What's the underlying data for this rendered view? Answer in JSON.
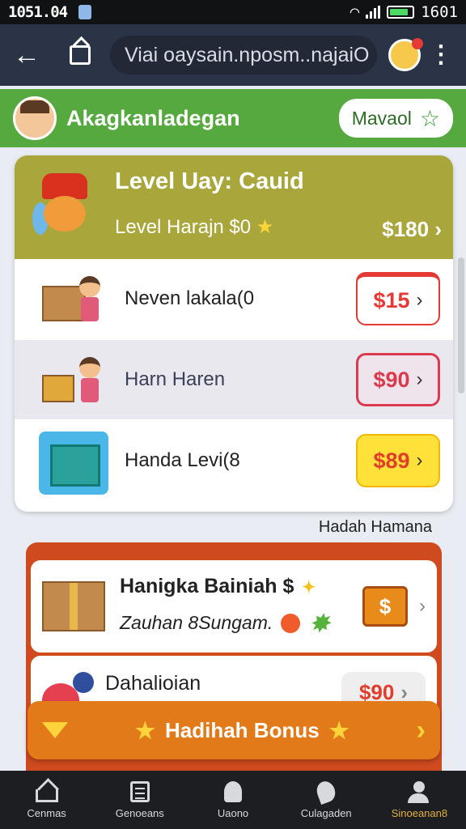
{
  "status": {
    "time": "1051.04",
    "right_text": "1601"
  },
  "browser": {
    "url": "Viai oaysain.nposm..najaiO"
  },
  "header": {
    "title": "Akagkanladegan",
    "manual_btn": "Mavaol"
  },
  "card": {
    "title": "Level Uay: Cauid",
    "subtitle": "Level Harajn  $0",
    "price": "$180",
    "rows": [
      {
        "label": "Neven lakala(0",
        "price": "$15",
        "bg": "#ffffff",
        "btn_bg": "#ffffff",
        "btn_border": "#e53935",
        "price_color": "#e53935"
      },
      {
        "label": "Harn Haren",
        "price": "$90",
        "bg": "#e8e8ee",
        "btn_bg": "#efe4ec",
        "btn_border": "#d93a4d",
        "price_color": "#d93a4d"
      },
      {
        "label": "Handa Levi(8",
        "price": "$89",
        "bg": "#ffffff",
        "btn_bg": "#ffe13a",
        "btn_border": "#f2b705",
        "price_color": "#e23d2b"
      }
    ]
  },
  "note": "Hadah Hamana",
  "lower": {
    "item1": {
      "title": "Hanigka Bainiah $",
      "subtitle": "Zauhan 8Sungam."
    },
    "item2": {
      "title": "Dahalioian",
      "price": "$90"
    }
  },
  "bonus": {
    "label": "Hadihah Bonus"
  },
  "nav": [
    {
      "icon": "home-icon",
      "label": "Cenmas"
    },
    {
      "icon": "document-icon",
      "label": "Genoeans"
    },
    {
      "icon": "map-icon",
      "label": "Uaono"
    },
    {
      "icon": "pin-icon",
      "label": "Culagaden"
    },
    {
      "icon": "profile-icon",
      "label": "Sinoeanan8"
    }
  ],
  "colors": {
    "accent_green": "#55a93f",
    "header_olive": "#a9a63c",
    "bonus_orange": "#e37a19",
    "nav_active": "#e2b13a"
  }
}
